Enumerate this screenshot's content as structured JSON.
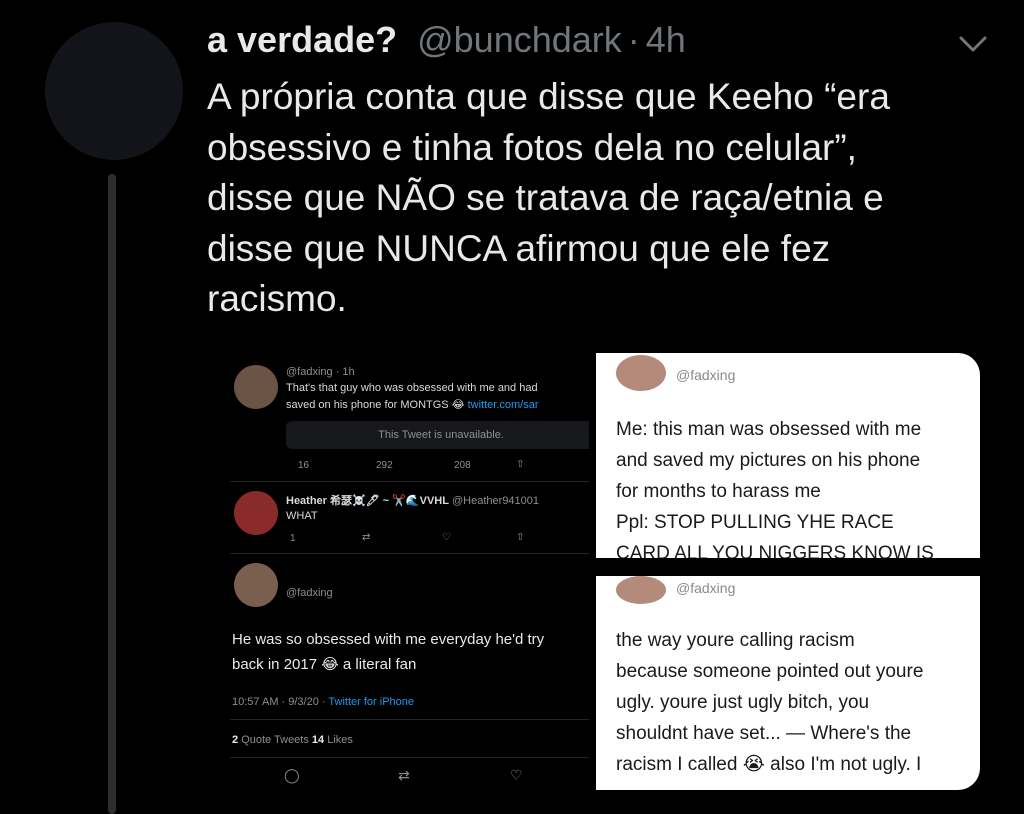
{
  "tweet": {
    "display_name": "a verdade?",
    "handle": "@bunchdark",
    "separator": "·",
    "time": "4h",
    "body_lines": [
      "A própria conta que disse que Keeho “era",
      "obsessivo e tinha fotos dela no celular”,",
      "disse que NÃO se tratava de raça/etnia e",
      "disse que NUNCA afirmou que ele fez",
      "racismo."
    ]
  },
  "media": {
    "left": {
      "tweet1_header": "@fadxing · 1h",
      "tweet1_line1": "That's that guy who was obsessed with me and had",
      "tweet1_line2a": "saved on his phone for MONTGS 😂",
      "tweet1_link": "twitter.com/sar",
      "unavailable": "This Tweet is unavailable.",
      "tweet1_actions": [
        "16",
        "292",
        "208"
      ],
      "tweet2_name": "Heather 希瑟☠️🖊 ~ ✂️🌊VVHL",
      "tweet2_handle": "@Heather941001",
      "tweet2_text": "WHAT",
      "tweet2_actions": [
        "1"
      ],
      "tweet3_handle": "@fadxing",
      "tweet3_line1": "He was so obsessed with me everyday he'd try",
      "tweet3_line2": "back in 2017 😂 a literal fan",
      "tweet3_meta": "10:57 AM · 9/3/20 · ",
      "tweet3_source": "Twitter for iPhone",
      "quote_count": "2",
      "quote_label": "Quote Tweets",
      "likes_count": "14",
      "likes_label": "Likes"
    },
    "right_top": {
      "handle": "@fadxing",
      "lines": [
        "Me: this man was obsessed with me",
        "and saved my pictures on his phone",
        "for months to harass me",
        "Ppl: STOP PULLING YHE RACE",
        "CARD ALL YOU NIGGERS KNOW IS"
      ]
    },
    "right_bottom": {
      "handle": "@fadxing",
      "lines": [
        "the way youre calling racism",
        "because someone pointed out youre",
        "ugly. youre just ugly bitch, you",
        "shouldnt have set... — Where's the",
        "racism I called 😭 also I'm not ugly. I"
      ]
    }
  },
  "colors": {
    "background": "#000000",
    "text": "#e7e9ea",
    "muted": "#71767b",
    "link": "#1d9bf0"
  },
  "icons": [
    "chevron-down-icon",
    "reply-icon",
    "retweet-icon",
    "like-icon",
    "share-icon"
  ]
}
